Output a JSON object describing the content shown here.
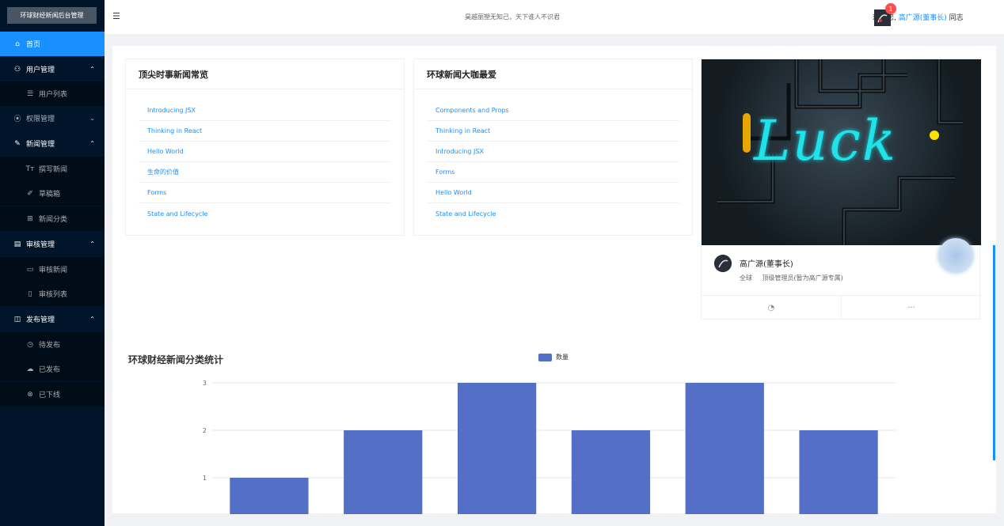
{
  "sidebar": {
    "logo": "环球财经新闻后台管理",
    "items": [
      {
        "label": "首页",
        "icon": "home-icon"
      },
      {
        "label": "用户管理",
        "icon": "user-icon"
      },
      {
        "label": "用户列表",
        "icon": "list-icon"
      },
      {
        "label": "权限管理",
        "icon": "permission-icon"
      },
      {
        "label": "新闻管理",
        "icon": "edit-icon"
      },
      {
        "label": "撰写新闻",
        "icon": "font-size-icon"
      },
      {
        "label": "草稿箱",
        "icon": "pen-icon"
      },
      {
        "label": "新闻分类",
        "icon": "cluster-icon"
      },
      {
        "label": "审核管理",
        "icon": "audit-icon"
      },
      {
        "label": "审核新闻",
        "icon": "message-icon"
      },
      {
        "label": "审核列表",
        "icon": "file-icon"
      },
      {
        "label": "发布管理",
        "icon": "publish-icon"
      },
      {
        "label": "待发布",
        "icon": "clock-icon"
      },
      {
        "label": "已发布",
        "icon": "upload-icon"
      },
      {
        "label": "已下线",
        "icon": "close-circle-icon"
      }
    ]
  },
  "header": {
    "motto": "昊越丽塑无知己，天下谁人不识君",
    "welcome_prefix": "欢迎您,",
    "user": "高广源(董事长)",
    "welcome_suffix": "同志",
    "badge_count": "1"
  },
  "cards": {
    "top_news": {
      "title": "顶尖时事新闻常览",
      "items": [
        "Introducing JSX",
        "Thinking in React",
        "Hello World",
        "生命的价值",
        "Forms",
        "State and Lifecycle"
      ]
    },
    "fav_news": {
      "title": "环球新闻大咖最爱",
      "items": [
        "Components and Props",
        "Thinking in React",
        "Introducing JSX",
        "Forms",
        "Hello World",
        "State and Lifecycle"
      ]
    },
    "profile": {
      "image_text": "Luck",
      "name": "高广源(董事长)",
      "region": "全球",
      "role": "顶级管理员(暂为高广源专属)",
      "actions": [
        "pie-chart-icon",
        "ellipsis-icon"
      ]
    }
  },
  "chart_data": {
    "type": "bar",
    "title": "环球财经新闻分类统计",
    "legend": "数量",
    "categories": [
      "",
      "",
      "",
      "",
      "",
      ""
    ],
    "series": [
      {
        "name": "数量",
        "values": [
          1,
          2,
          3,
          2,
          3,
          2
        ]
      }
    ],
    "yticks": [
      "1",
      "2",
      "3"
    ],
    "ylim": [
      0,
      3
    ],
    "color": "#5470c6",
    "grid": true
  }
}
